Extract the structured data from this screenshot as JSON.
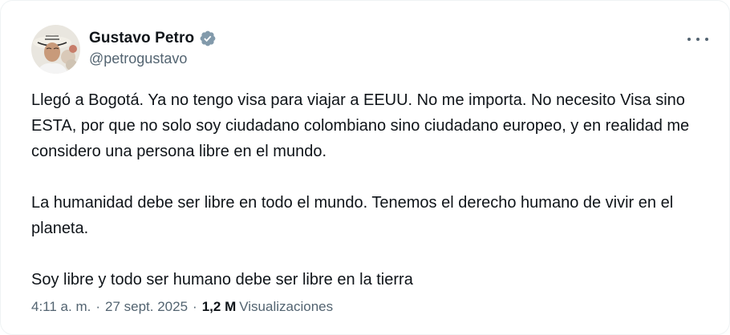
{
  "tweet": {
    "author": {
      "display_name": "Gustavo Petro",
      "handle": "@petrogustavo",
      "verified": true,
      "verified_color": "#829aab"
    },
    "text_paragraphs": [
      "Llegó a Bogotá. Ya no tengo visa para viajar a EEUU. No me importa. No necesito Visa sino ESTA, por que no solo soy ciudadano colombiano sino ciudadano europeo, y en realidad me considero una persona libre en el mundo.",
      "La humanidad debe ser libre en todo el mundo. Tenemos el derecho humano de vivir en el planeta.",
      "Soy libre y todo ser humano debe ser libre en la tierra"
    ],
    "time": "4:11 a. m.",
    "separator": "·",
    "date": "27 sept. 2025",
    "views_count": "1,2 M",
    "views_label": "Visualizaciones",
    "more_icon": "more-horizontal-icon"
  },
  "colors": {
    "text_primary": "#0f1419",
    "text_secondary": "#536471"
  }
}
